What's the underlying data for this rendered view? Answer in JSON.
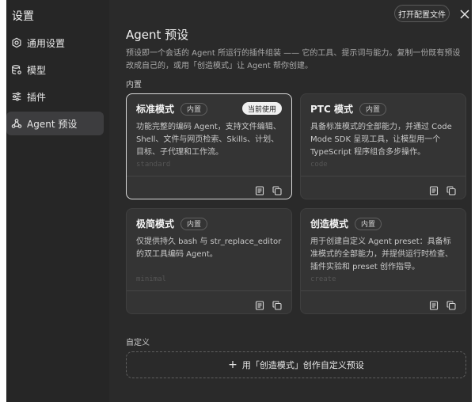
{
  "app": {
    "title": "设置"
  },
  "sidebar": {
    "items": [
      {
        "label": "通用设置",
        "icon": "gear-icon"
      },
      {
        "label": "模型",
        "icon": "database-icon"
      },
      {
        "label": "插件",
        "icon": "sliders-icon"
      },
      {
        "label": "Agent 预设",
        "icon": "agent-icon"
      }
    ],
    "active_index": 3
  },
  "header": {
    "open_config_label": "打开配置文件"
  },
  "main": {
    "title": "Agent 预设",
    "description": "预设即一个会话的 Agent 所运行的插件组装 —— 它的工具、提示词与能力。复制一份既有预设改成自己的，或用「创造模式」让 Agent 帮你创建。",
    "builtin_label": "内置",
    "custom_label": "自定义",
    "create_custom_label": "用「创造模式」创作自定义预设"
  },
  "presets": [
    {
      "name": "标准模式",
      "badge": "内置",
      "current_tag": "当前使用",
      "desc": "功能完整的编码 Agent，支持文件编辑、Shell、文件与网页检索、Skills、计划、目标、子代理和工作流。",
      "id": "standard"
    },
    {
      "name": "PTC 模式",
      "badge": "内置",
      "desc": "具备标准模式的全部能力，并通过 Code Mode SDK 呈现工具，让模型用一个 TypeScript 程序组合多步操作。",
      "id": "code"
    },
    {
      "name": "极简模式",
      "badge": "内置",
      "desc": "仅提供持久 bash 与 str_replace_editor 的双工具编码 Agent。",
      "id": "minimal"
    },
    {
      "name": "创造模式",
      "badge": "内置",
      "desc": "用于创建自定义 Agent preset：具备标准模式的全部能力，并提供运行时检查、插件实验和 preset 创作指导。",
      "id": "create"
    }
  ]
}
